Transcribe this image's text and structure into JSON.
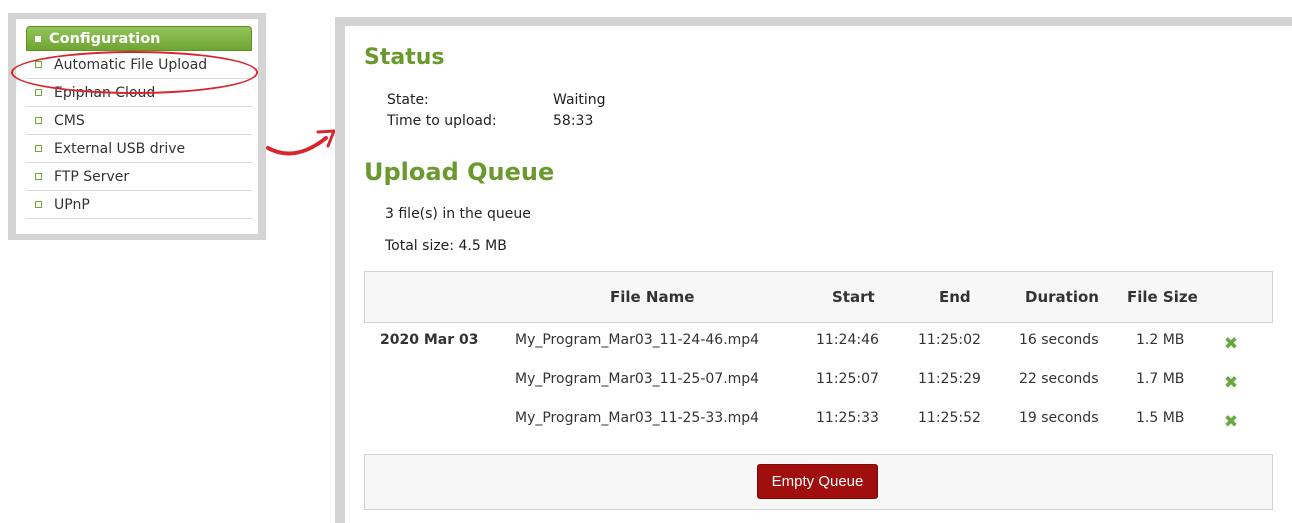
{
  "menu": {
    "header": "Configuration",
    "items": [
      {
        "label": "Automatic File Upload"
      },
      {
        "label": "Epiphan Cloud"
      },
      {
        "label": "CMS"
      },
      {
        "label": "External USB drive"
      },
      {
        "label": "FTP Server"
      },
      {
        "label": "UPnP"
      }
    ]
  },
  "status": {
    "title": "Status",
    "state_label": "State:",
    "state_value": "Waiting",
    "time_label": "Time to upload:",
    "time_value": "58:33"
  },
  "queue": {
    "title": "Upload Queue",
    "count_text": "3 file(s) in the queue",
    "size_text": "Total size: 4.5 MB",
    "columns": [
      "File Name",
      "Start",
      "End",
      "Duration",
      "File Size"
    ],
    "rows": [
      {
        "date": "2020 Mar 03",
        "file": "My_Program_Mar03_11-24-46.mp4",
        "start": "11:24:46",
        "end": "11:25:02",
        "duration": "16 seconds",
        "size": "1.2 MB"
      },
      {
        "date": "",
        "file": "My_Program_Mar03_11-25-07.mp4",
        "start": "11:25:07",
        "end": "11:25:29",
        "duration": "22 seconds",
        "size": "1.7 MB"
      },
      {
        "date": "",
        "file": "My_Program_Mar03_11-25-33.mp4",
        "start": "11:25:33",
        "end": "11:25:52",
        "duration": "19 seconds",
        "size": "1.5 MB"
      }
    ],
    "empty_button": "Empty Queue"
  },
  "colors": {
    "accent_green": "#6a9a2e",
    "button_red": "#a00e0e",
    "highlight_red": "#d7262e"
  },
  "icons": {
    "delete": "close-x-icon",
    "bullet": "square-bullet-icon",
    "arrow": "curved-arrow-icon"
  }
}
